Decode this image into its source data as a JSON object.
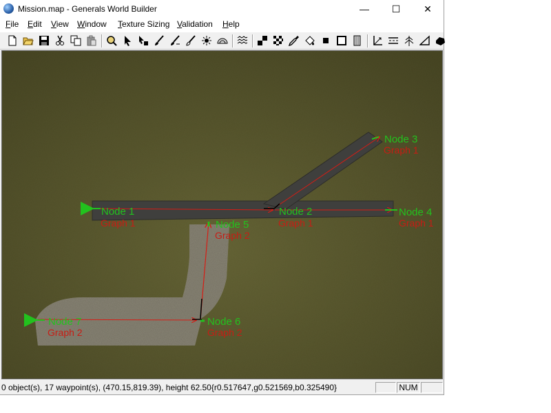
{
  "window": {
    "title": "Mission.map - Generals World Builder",
    "controls": {
      "minimize": "—",
      "maximize": "☐",
      "close": "✕"
    }
  },
  "menu": [
    "File",
    "Edit",
    "View",
    "Window",
    "Texture Sizing",
    "Validation",
    "Help"
  ],
  "toolbar": {
    "buttons": [
      "new-file-icon",
      "open-folder-icon",
      "save-icon",
      "cut-icon",
      "copy-icon",
      "paste-icon",
      "zoom-icon",
      "pointer-icon",
      "object-tool-icon",
      "brush-icon",
      "brush-feather-icon",
      "brush-smooth-icon",
      "sun-icon",
      "tint-icon",
      "water-icon",
      "checker-icon",
      "checker-fine-icon",
      "eyedropper-icon",
      "fill-icon",
      "square-icon",
      "square-outline-icon",
      "wall-icon",
      "waypoint-icon",
      "road-icon",
      "tree-icon",
      "ramp-icon",
      "bridge-icon"
    ]
  },
  "waypoints": [
    {
      "name": "Node 1",
      "graph": "Graph 1"
    },
    {
      "name": "Node 2",
      "graph": "Graph 1"
    },
    {
      "name": "Node 3",
      "graph": "Graph 1"
    },
    {
      "name": "Node 4",
      "graph": "Graph 1"
    },
    {
      "name": "Node 5",
      "graph": "Graph 2"
    },
    {
      "name": "Node 6",
      "graph": "Graph 2"
    },
    {
      "name": "Node 7",
      "graph": "Graph 2"
    }
  ],
  "status": {
    "text": "0 object(s), 17 waypoint(s), (470.15,819.39), height 62.50{r0.517647,g0.521569,b0.325490}",
    "pane_1": "",
    "pane_num": "NUM",
    "pane_3": ""
  },
  "colors": {
    "waypoint_label": "#22c21e",
    "graph_label": "#c81c14",
    "link_line": "#d81c14",
    "terrain": "#5c5a30"
  }
}
